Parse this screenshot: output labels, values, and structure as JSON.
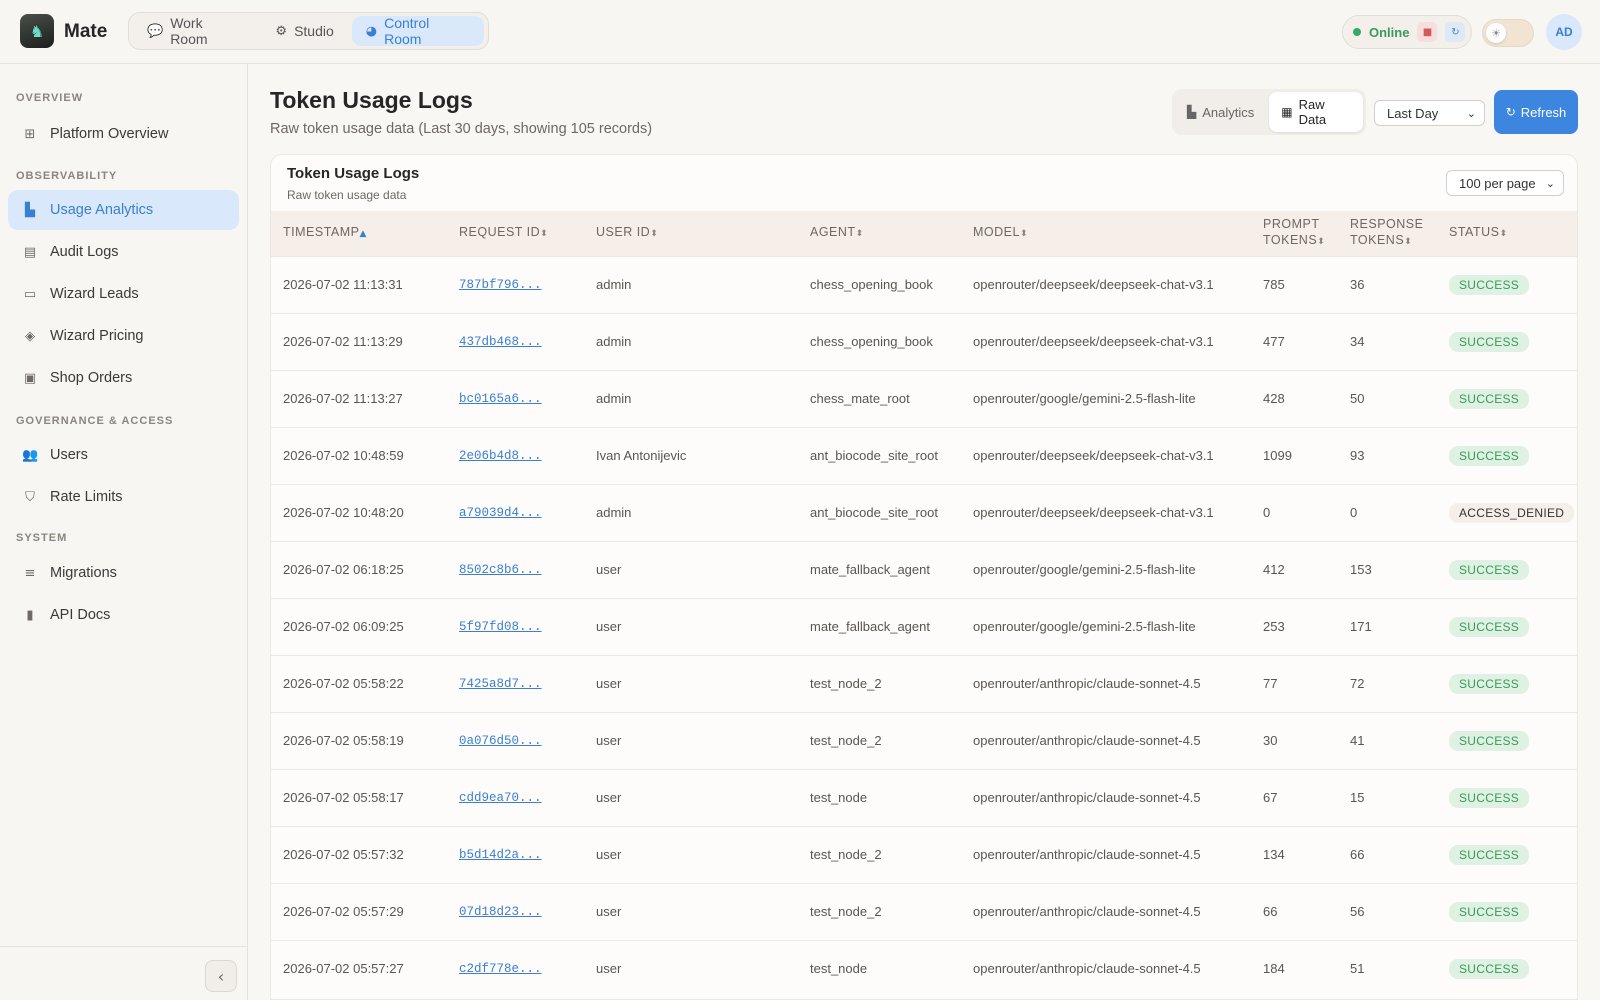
{
  "app": {
    "brand": "Mate",
    "logo_icon": "chess-piece-logo"
  },
  "nav": {
    "tabs": [
      {
        "label": "Work Room",
        "icon": "chat-icon"
      },
      {
        "label": "Studio",
        "icon": "robot-icon"
      },
      {
        "label": "Control Room",
        "icon": "gauge-icon",
        "active": true
      }
    ]
  },
  "header": {
    "status": "Online",
    "avatar": "AD"
  },
  "sidebar": {
    "sections": [
      {
        "title": "OVERVIEW",
        "items": [
          {
            "label": "Platform Overview",
            "icon": "grid-icon"
          }
        ]
      },
      {
        "title": "OBSERVABILITY",
        "items": [
          {
            "label": "Usage Analytics",
            "icon": "chart-icon",
            "active": true
          },
          {
            "label": "Audit Logs",
            "icon": "clipboard-icon"
          },
          {
            "label": "Wizard Leads",
            "icon": "inbox-icon"
          },
          {
            "label": "Wizard Pricing",
            "icon": "tags-icon"
          },
          {
            "label": "Shop Orders",
            "icon": "bag-icon"
          }
        ]
      },
      {
        "title": "GOVERNANCE & ACCESS",
        "items": [
          {
            "label": "Users",
            "icon": "users-icon"
          },
          {
            "label": "Rate Limits",
            "icon": "shield-icon"
          }
        ]
      },
      {
        "title": "SYSTEM",
        "items": [
          {
            "label": "Migrations",
            "icon": "database-icon"
          },
          {
            "label": "API Docs",
            "icon": "book-icon"
          }
        ]
      }
    ]
  },
  "page": {
    "title": "Token Usage Logs",
    "subtitle": "Raw token usage data (Last 30 days, showing 105 records)",
    "view_toggle": {
      "analytics": "Analytics",
      "raw": "Raw Data",
      "active": "raw"
    },
    "range": "Last Day",
    "refresh": "Refresh"
  },
  "card": {
    "title": "Token Usage Logs",
    "subtitle": "Raw token usage data",
    "per_page": "100 per page"
  },
  "table": {
    "columns": [
      {
        "label": "TIMESTAMP",
        "label2": "",
        "sort": "asc"
      },
      {
        "label": "REQUEST ID",
        "label2": "",
        "sort": "both"
      },
      {
        "label": "USER ID",
        "label2": "",
        "sort": "both"
      },
      {
        "label": "AGENT",
        "label2": "",
        "sort": "both"
      },
      {
        "label": "MODEL",
        "label2": "",
        "sort": "both"
      },
      {
        "label": "PROMPT",
        "label2": "TOKENS",
        "sort": "both"
      },
      {
        "label": "RESPONSE",
        "label2": "TOKENS",
        "sort": "both"
      },
      {
        "label": "STATUS",
        "label2": "",
        "sort": "both"
      }
    ],
    "rows": [
      {
        "timestamp": "2026-07-02 11:13:31",
        "request_id": "787bf796...",
        "user_id": "admin",
        "agent": "chess_opening_book",
        "model": "openrouter/deepseek/deepseek-chat-v3.1",
        "prompt_tokens": "785",
        "response_tokens": "36",
        "status": "SUCCESS"
      },
      {
        "timestamp": "2026-07-02 11:13:29",
        "request_id": "437db468...",
        "user_id": "admin",
        "agent": "chess_opening_book",
        "model": "openrouter/deepseek/deepseek-chat-v3.1",
        "prompt_tokens": "477",
        "response_tokens": "34",
        "status": "SUCCESS"
      },
      {
        "timestamp": "2026-07-02 11:13:27",
        "request_id": "bc0165a6...",
        "user_id": "admin",
        "agent": "chess_mate_root",
        "model": "openrouter/google/gemini-2.5-flash-lite",
        "prompt_tokens": "428",
        "response_tokens": "50",
        "status": "SUCCESS"
      },
      {
        "timestamp": "2026-07-02 10:48:59",
        "request_id": "2e06b4d8...",
        "user_id": "Ivan Antonijevic",
        "agent": "ant_biocode_site_root",
        "model": "openrouter/deepseek/deepseek-chat-v3.1",
        "prompt_tokens": "1099",
        "response_tokens": "93",
        "status": "SUCCESS"
      },
      {
        "timestamp": "2026-07-02 10:48:20",
        "request_id": "a79039d4...",
        "user_id": "admin",
        "agent": "ant_biocode_site_root",
        "model": "openrouter/deepseek/deepseek-chat-v3.1",
        "prompt_tokens": "0",
        "response_tokens": "0",
        "status": "ACCESS_DENIED"
      },
      {
        "timestamp": "2026-07-02 06:18:25",
        "request_id": "8502c8b6...",
        "user_id": "user",
        "agent": "mate_fallback_agent",
        "model": "openrouter/google/gemini-2.5-flash-lite",
        "prompt_tokens": "412",
        "response_tokens": "153",
        "status": "SUCCESS"
      },
      {
        "timestamp": "2026-07-02 06:09:25",
        "request_id": "5f97fd08...",
        "user_id": "user",
        "agent": "mate_fallback_agent",
        "model": "openrouter/google/gemini-2.5-flash-lite",
        "prompt_tokens": "253",
        "response_tokens": "171",
        "status": "SUCCESS"
      },
      {
        "timestamp": "2026-07-02 05:58:22",
        "request_id": "7425a8d7...",
        "user_id": "user",
        "agent": "test_node_2",
        "model": "openrouter/anthropic/claude-sonnet-4.5",
        "prompt_tokens": "77",
        "response_tokens": "72",
        "status": "SUCCESS"
      },
      {
        "timestamp": "2026-07-02 05:58:19",
        "request_id": "0a076d50...",
        "user_id": "user",
        "agent": "test_node_2",
        "model": "openrouter/anthropic/claude-sonnet-4.5",
        "prompt_tokens": "30",
        "response_tokens": "41",
        "status": "SUCCESS"
      },
      {
        "timestamp": "2026-07-02 05:58:17",
        "request_id": "cdd9ea70...",
        "user_id": "user",
        "agent": "test_node",
        "model": "openrouter/anthropic/claude-sonnet-4.5",
        "prompt_tokens": "67",
        "response_tokens": "15",
        "status": "SUCCESS"
      },
      {
        "timestamp": "2026-07-02 05:57:32",
        "request_id": "b5d14d2a...",
        "user_id": "user",
        "agent": "test_node_2",
        "model": "openrouter/anthropic/claude-sonnet-4.5",
        "prompt_tokens": "134",
        "response_tokens": "66",
        "status": "SUCCESS"
      },
      {
        "timestamp": "2026-07-02 05:57:29",
        "request_id": "07d18d23...",
        "user_id": "user",
        "agent": "test_node_2",
        "model": "openrouter/anthropic/claude-sonnet-4.5",
        "prompt_tokens": "66",
        "response_tokens": "56",
        "status": "SUCCESS"
      },
      {
        "timestamp": "2026-07-02 05:57:27",
        "request_id": "c2df778e...",
        "user_id": "user",
        "agent": "test_node",
        "model": "openrouter/anthropic/claude-sonnet-4.5",
        "prompt_tokens": "184",
        "response_tokens": "51",
        "status": "SUCCESS"
      }
    ]
  },
  "colors": {
    "accent": "#3a7fd1",
    "success_bg": "#def1e2",
    "success_text": "#3a9a5c",
    "online": "#3aa864"
  }
}
